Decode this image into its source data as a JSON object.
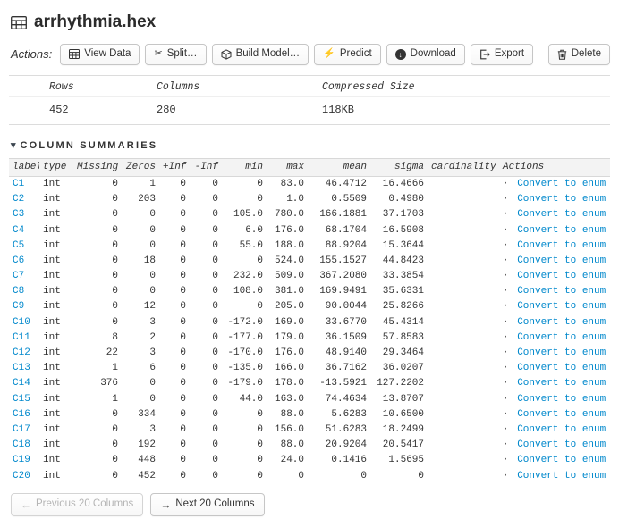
{
  "colors": {
    "link": "#0088cc",
    "table_header_bg": "#f3f3f3",
    "border": "#d8d8d8"
  },
  "header": {
    "title": "arrhythmia.hex"
  },
  "actions": {
    "label": "Actions:",
    "buttons": [
      {
        "label": "View Data",
        "icon": "table-icon"
      },
      {
        "label": "Split…",
        "icon": "scissors-icon"
      },
      {
        "label": "Build Model…",
        "icon": "cube-icon"
      },
      {
        "label": "Predict",
        "icon": "bolt-icon"
      },
      {
        "label": "Download",
        "icon": "download-icon"
      },
      {
        "label": "Export",
        "icon": "export-icon"
      }
    ],
    "delete": {
      "label": "Delete",
      "icon": "trash-icon"
    }
  },
  "summary": {
    "headers": [
      "Rows",
      "Columns",
      "Compressed Size"
    ],
    "values": [
      "452",
      "280",
      "118KB"
    ]
  },
  "section": {
    "caret": "▾",
    "title": "COLUMN SUMMARIES"
  },
  "icons": {
    "scissors": "✂",
    "bolt": "⚡",
    "download_arrow": "↓",
    "prev_arrow": "←",
    "next_arrow": "→"
  },
  "table": {
    "headers": [
      "label",
      "type",
      "Missing",
      "Zeros",
      "+Inf",
      "-Inf",
      "min",
      "max",
      "mean",
      "sigma",
      "cardinality",
      "Actions"
    ],
    "separator": "·",
    "action_label": "Convert to enum",
    "rows": [
      {
        "label": "C1",
        "type": "int",
        "missing": "0",
        "zeros": "1",
        "pinf": "0",
        "ninf": "0",
        "min": "0",
        "max": "83.0",
        "mean": "46.4712",
        "sigma": "16.4666"
      },
      {
        "label": "C2",
        "type": "int",
        "missing": "0",
        "zeros": "203",
        "pinf": "0",
        "ninf": "0",
        "min": "0",
        "max": "1.0",
        "mean": "0.5509",
        "sigma": "0.4980"
      },
      {
        "label": "C3",
        "type": "int",
        "missing": "0",
        "zeros": "0",
        "pinf": "0",
        "ninf": "0",
        "min": "105.0",
        "max": "780.0",
        "mean": "166.1881",
        "sigma": "37.1703"
      },
      {
        "label": "C4",
        "type": "int",
        "missing": "0",
        "zeros": "0",
        "pinf": "0",
        "ninf": "0",
        "min": "6.0",
        "max": "176.0",
        "mean": "68.1704",
        "sigma": "16.5908"
      },
      {
        "label": "C5",
        "type": "int",
        "missing": "0",
        "zeros": "0",
        "pinf": "0",
        "ninf": "0",
        "min": "55.0",
        "max": "188.0",
        "mean": "88.9204",
        "sigma": "15.3644"
      },
      {
        "label": "C6",
        "type": "int",
        "missing": "0",
        "zeros": "18",
        "pinf": "0",
        "ninf": "0",
        "min": "0",
        "max": "524.0",
        "mean": "155.1527",
        "sigma": "44.8423"
      },
      {
        "label": "C7",
        "type": "int",
        "missing": "0",
        "zeros": "0",
        "pinf": "0",
        "ninf": "0",
        "min": "232.0",
        "max": "509.0",
        "mean": "367.2080",
        "sigma": "33.3854"
      },
      {
        "label": "C8",
        "type": "int",
        "missing": "0",
        "zeros": "0",
        "pinf": "0",
        "ninf": "0",
        "min": "108.0",
        "max": "381.0",
        "mean": "169.9491",
        "sigma": "35.6331"
      },
      {
        "label": "C9",
        "type": "int",
        "missing": "0",
        "zeros": "12",
        "pinf": "0",
        "ninf": "0",
        "min": "0",
        "max": "205.0",
        "mean": "90.0044",
        "sigma": "25.8266"
      },
      {
        "label": "C10",
        "type": "int",
        "missing": "0",
        "zeros": "3",
        "pinf": "0",
        "ninf": "0",
        "min": "-172.0",
        "max": "169.0",
        "mean": "33.6770",
        "sigma": "45.4314"
      },
      {
        "label": "C11",
        "type": "int",
        "missing": "8",
        "zeros": "2",
        "pinf": "0",
        "ninf": "0",
        "min": "-177.0",
        "max": "179.0",
        "mean": "36.1509",
        "sigma": "57.8583"
      },
      {
        "label": "C12",
        "type": "int",
        "missing": "22",
        "zeros": "3",
        "pinf": "0",
        "ninf": "0",
        "min": "-170.0",
        "max": "176.0",
        "mean": "48.9140",
        "sigma": "29.3464"
      },
      {
        "label": "C13",
        "type": "int",
        "missing": "1",
        "zeros": "6",
        "pinf": "0",
        "ninf": "0",
        "min": "-135.0",
        "max": "166.0",
        "mean": "36.7162",
        "sigma": "36.0207"
      },
      {
        "label": "C14",
        "type": "int",
        "missing": "376",
        "zeros": "0",
        "pinf": "0",
        "ninf": "0",
        "min": "-179.0",
        "max": "178.0",
        "mean": "-13.5921",
        "sigma": "127.2202"
      },
      {
        "label": "C15",
        "type": "int",
        "missing": "1",
        "zeros": "0",
        "pinf": "0",
        "ninf": "0",
        "min": "44.0",
        "max": "163.0",
        "mean": "74.4634",
        "sigma": "13.8707"
      },
      {
        "label": "C16",
        "type": "int",
        "missing": "0",
        "zeros": "334",
        "pinf": "0",
        "ninf": "0",
        "min": "0",
        "max": "88.0",
        "mean": "5.6283",
        "sigma": "10.6500"
      },
      {
        "label": "C17",
        "type": "int",
        "missing": "0",
        "zeros": "3",
        "pinf": "0",
        "ninf": "0",
        "min": "0",
        "max": "156.0",
        "mean": "51.6283",
        "sigma": "18.2499"
      },
      {
        "label": "C18",
        "type": "int",
        "missing": "0",
        "zeros": "192",
        "pinf": "0",
        "ninf": "0",
        "min": "0",
        "max": "88.0",
        "mean": "20.9204",
        "sigma": "20.5417"
      },
      {
        "label": "C19",
        "type": "int",
        "missing": "0",
        "zeros": "448",
        "pinf": "0",
        "ninf": "0",
        "min": "0",
        "max": "24.0",
        "mean": "0.1416",
        "sigma": "1.5695"
      },
      {
        "label": "C20",
        "type": "int",
        "missing": "0",
        "zeros": "452",
        "pinf": "0",
        "ninf": "0",
        "min": "0",
        "max": "0",
        "mean": "0",
        "sigma": "0"
      }
    ]
  },
  "footer": {
    "previous": {
      "label": "Previous 20 Columns",
      "disabled": true
    },
    "next": {
      "label": "Next 20 Columns",
      "disabled": false
    }
  }
}
